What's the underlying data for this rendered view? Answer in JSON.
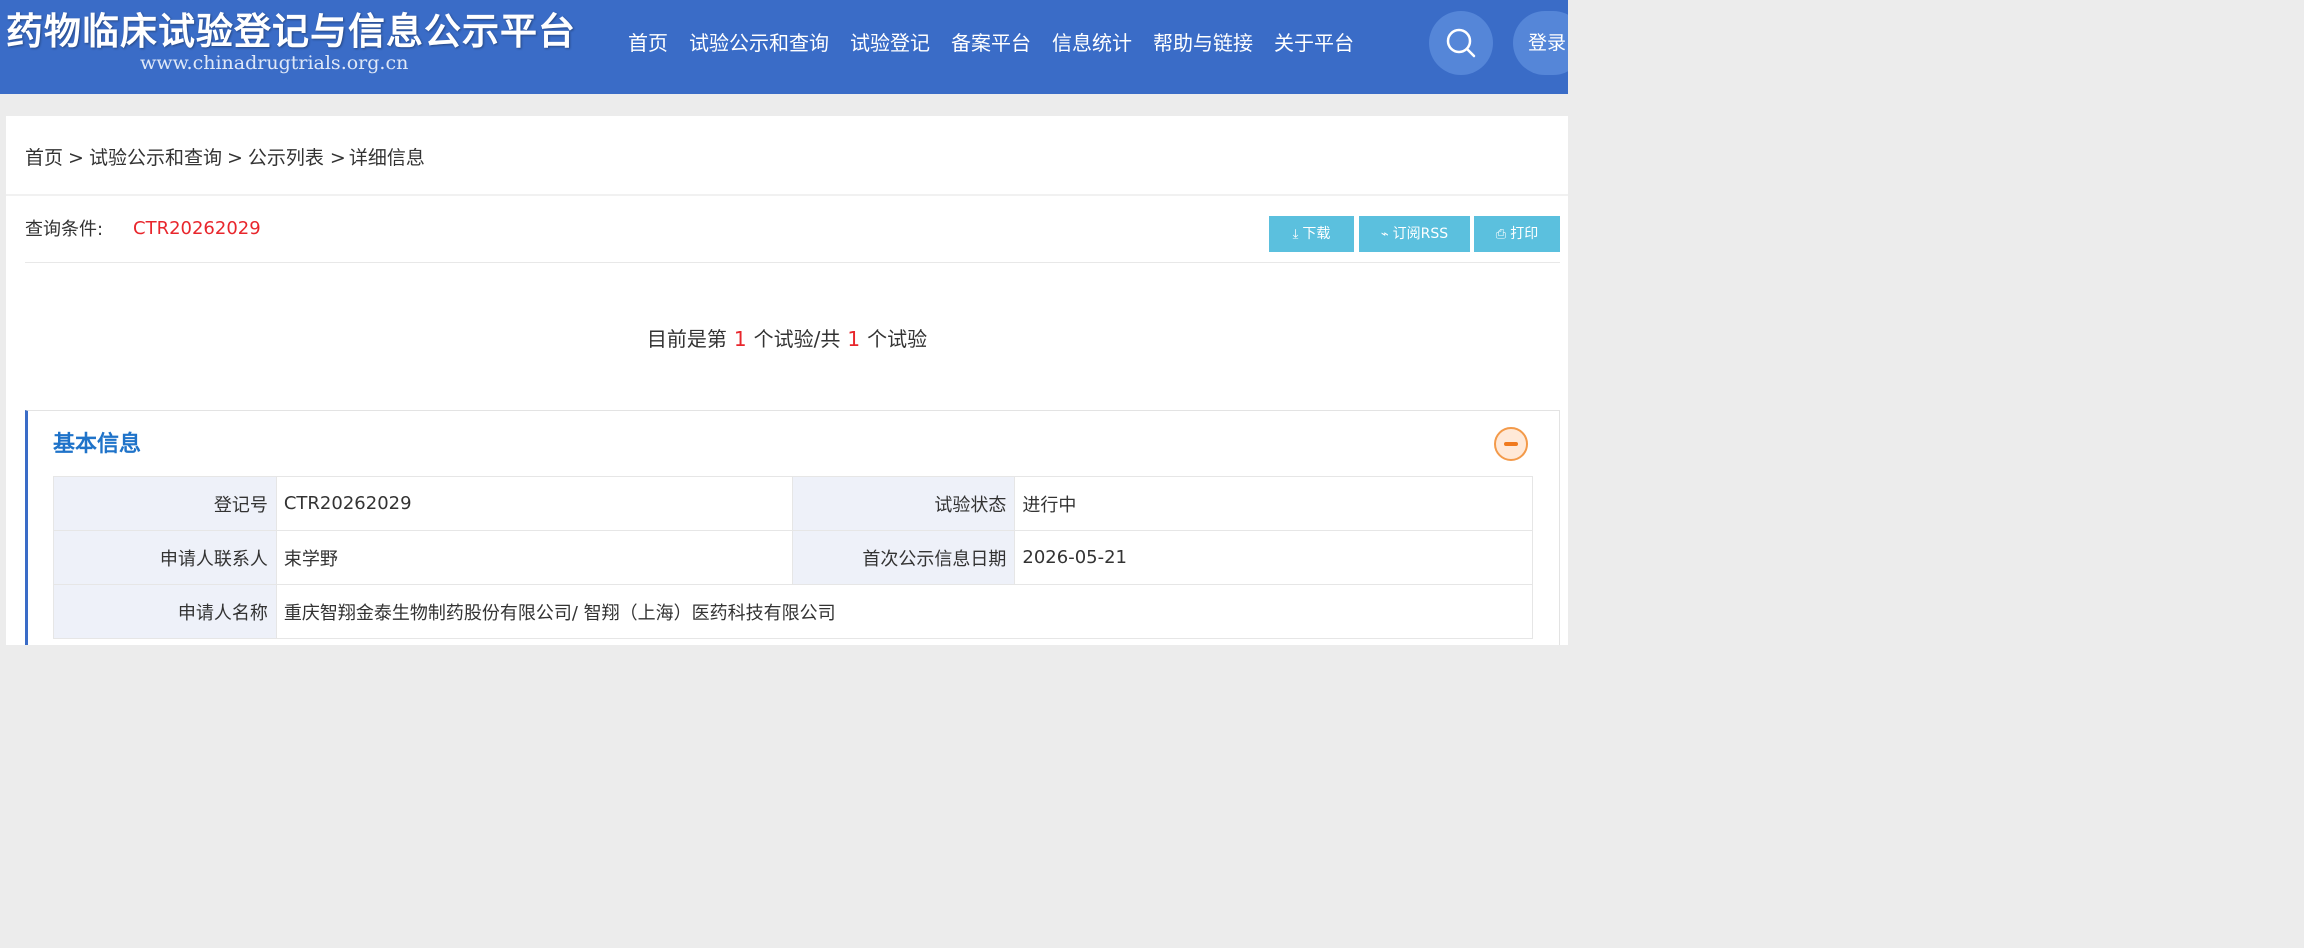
{
  "header": {
    "site_title": "药物临床试验登记与信息公示平台",
    "site_url": "www.chinadrugtrials.org.cn",
    "nav": [
      "首页",
      "试验公示和查询",
      "试验登记",
      "备案平台",
      "信息统计",
      "帮助与链接",
      "关于平台"
    ],
    "search_icon": "search-icon",
    "login_label": "登录"
  },
  "breadcrumb": {
    "home": "首页",
    "sep": ">",
    "level2": "试验公示和查询",
    "level3": "公示列表",
    "current": "详细信息"
  },
  "query": {
    "label": "查询条件:",
    "value": "CTR20262029"
  },
  "toolbar": {
    "download_label": "下载",
    "rss_label": "订阅RSS",
    "print_label": "打印",
    "download_icon": "download-icon",
    "rss_icon": "rss-icon",
    "print_icon": "print-icon"
  },
  "counter": {
    "prefix": "目前是第",
    "current": "1",
    "middle": "个试验/共",
    "total": "1",
    "suffix": "个试验"
  },
  "basic_info": {
    "title": "基本信息",
    "collapse_icon": "minus-circle-icon",
    "rows": [
      [
        {
          "label": "登记号",
          "value": "CTR20262029"
        },
        {
          "label": "试验状态",
          "value": "进行中"
        }
      ],
      [
        {
          "label": "申请人联系人",
          "value": "束学野"
        },
        {
          "label": "首次公示信息日期",
          "value": "2026-05-21"
        }
      ],
      [
        {
          "label": "申请人名称",
          "value": "重庆智翔金泰生物制药股份有限公司/ 智翔（上海）医药科技有限公司"
        }
      ]
    ]
  },
  "colors": {
    "header_bg": "#3a6cc7",
    "accent_red": "#e8262c",
    "button_bg": "#5bc0de",
    "section_title": "#1f73c9",
    "collapse_orange": "#f07a1e"
  }
}
